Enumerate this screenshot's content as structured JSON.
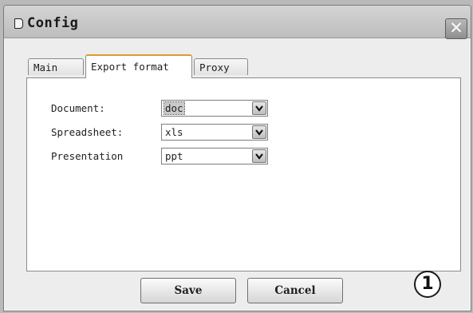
{
  "window": {
    "title": "Config",
    "close_label": "✕"
  },
  "tabs": [
    {
      "label": "Main",
      "active": false
    },
    {
      "label": "Export format",
      "active": true
    },
    {
      "label": "Proxy",
      "active": false
    }
  ],
  "export_format": {
    "rows": [
      {
        "label": "Document:",
        "value": "doc"
      },
      {
        "label": "Spreadsheet:",
        "value": "xls"
      },
      {
        "label": "Presentation",
        "value": "ppt"
      }
    ]
  },
  "buttons": {
    "save_label": "Save",
    "cancel_label": "Cancel"
  },
  "callout": {
    "number": "1"
  },
  "icons": {
    "app": "document-icon",
    "close": "close-icon",
    "dropdown": "chevron-down-icon"
  },
  "colors": {
    "active_tab_accent": "#d99a3a",
    "titlebar": "#c6c6c6",
    "background": "#ededed"
  }
}
